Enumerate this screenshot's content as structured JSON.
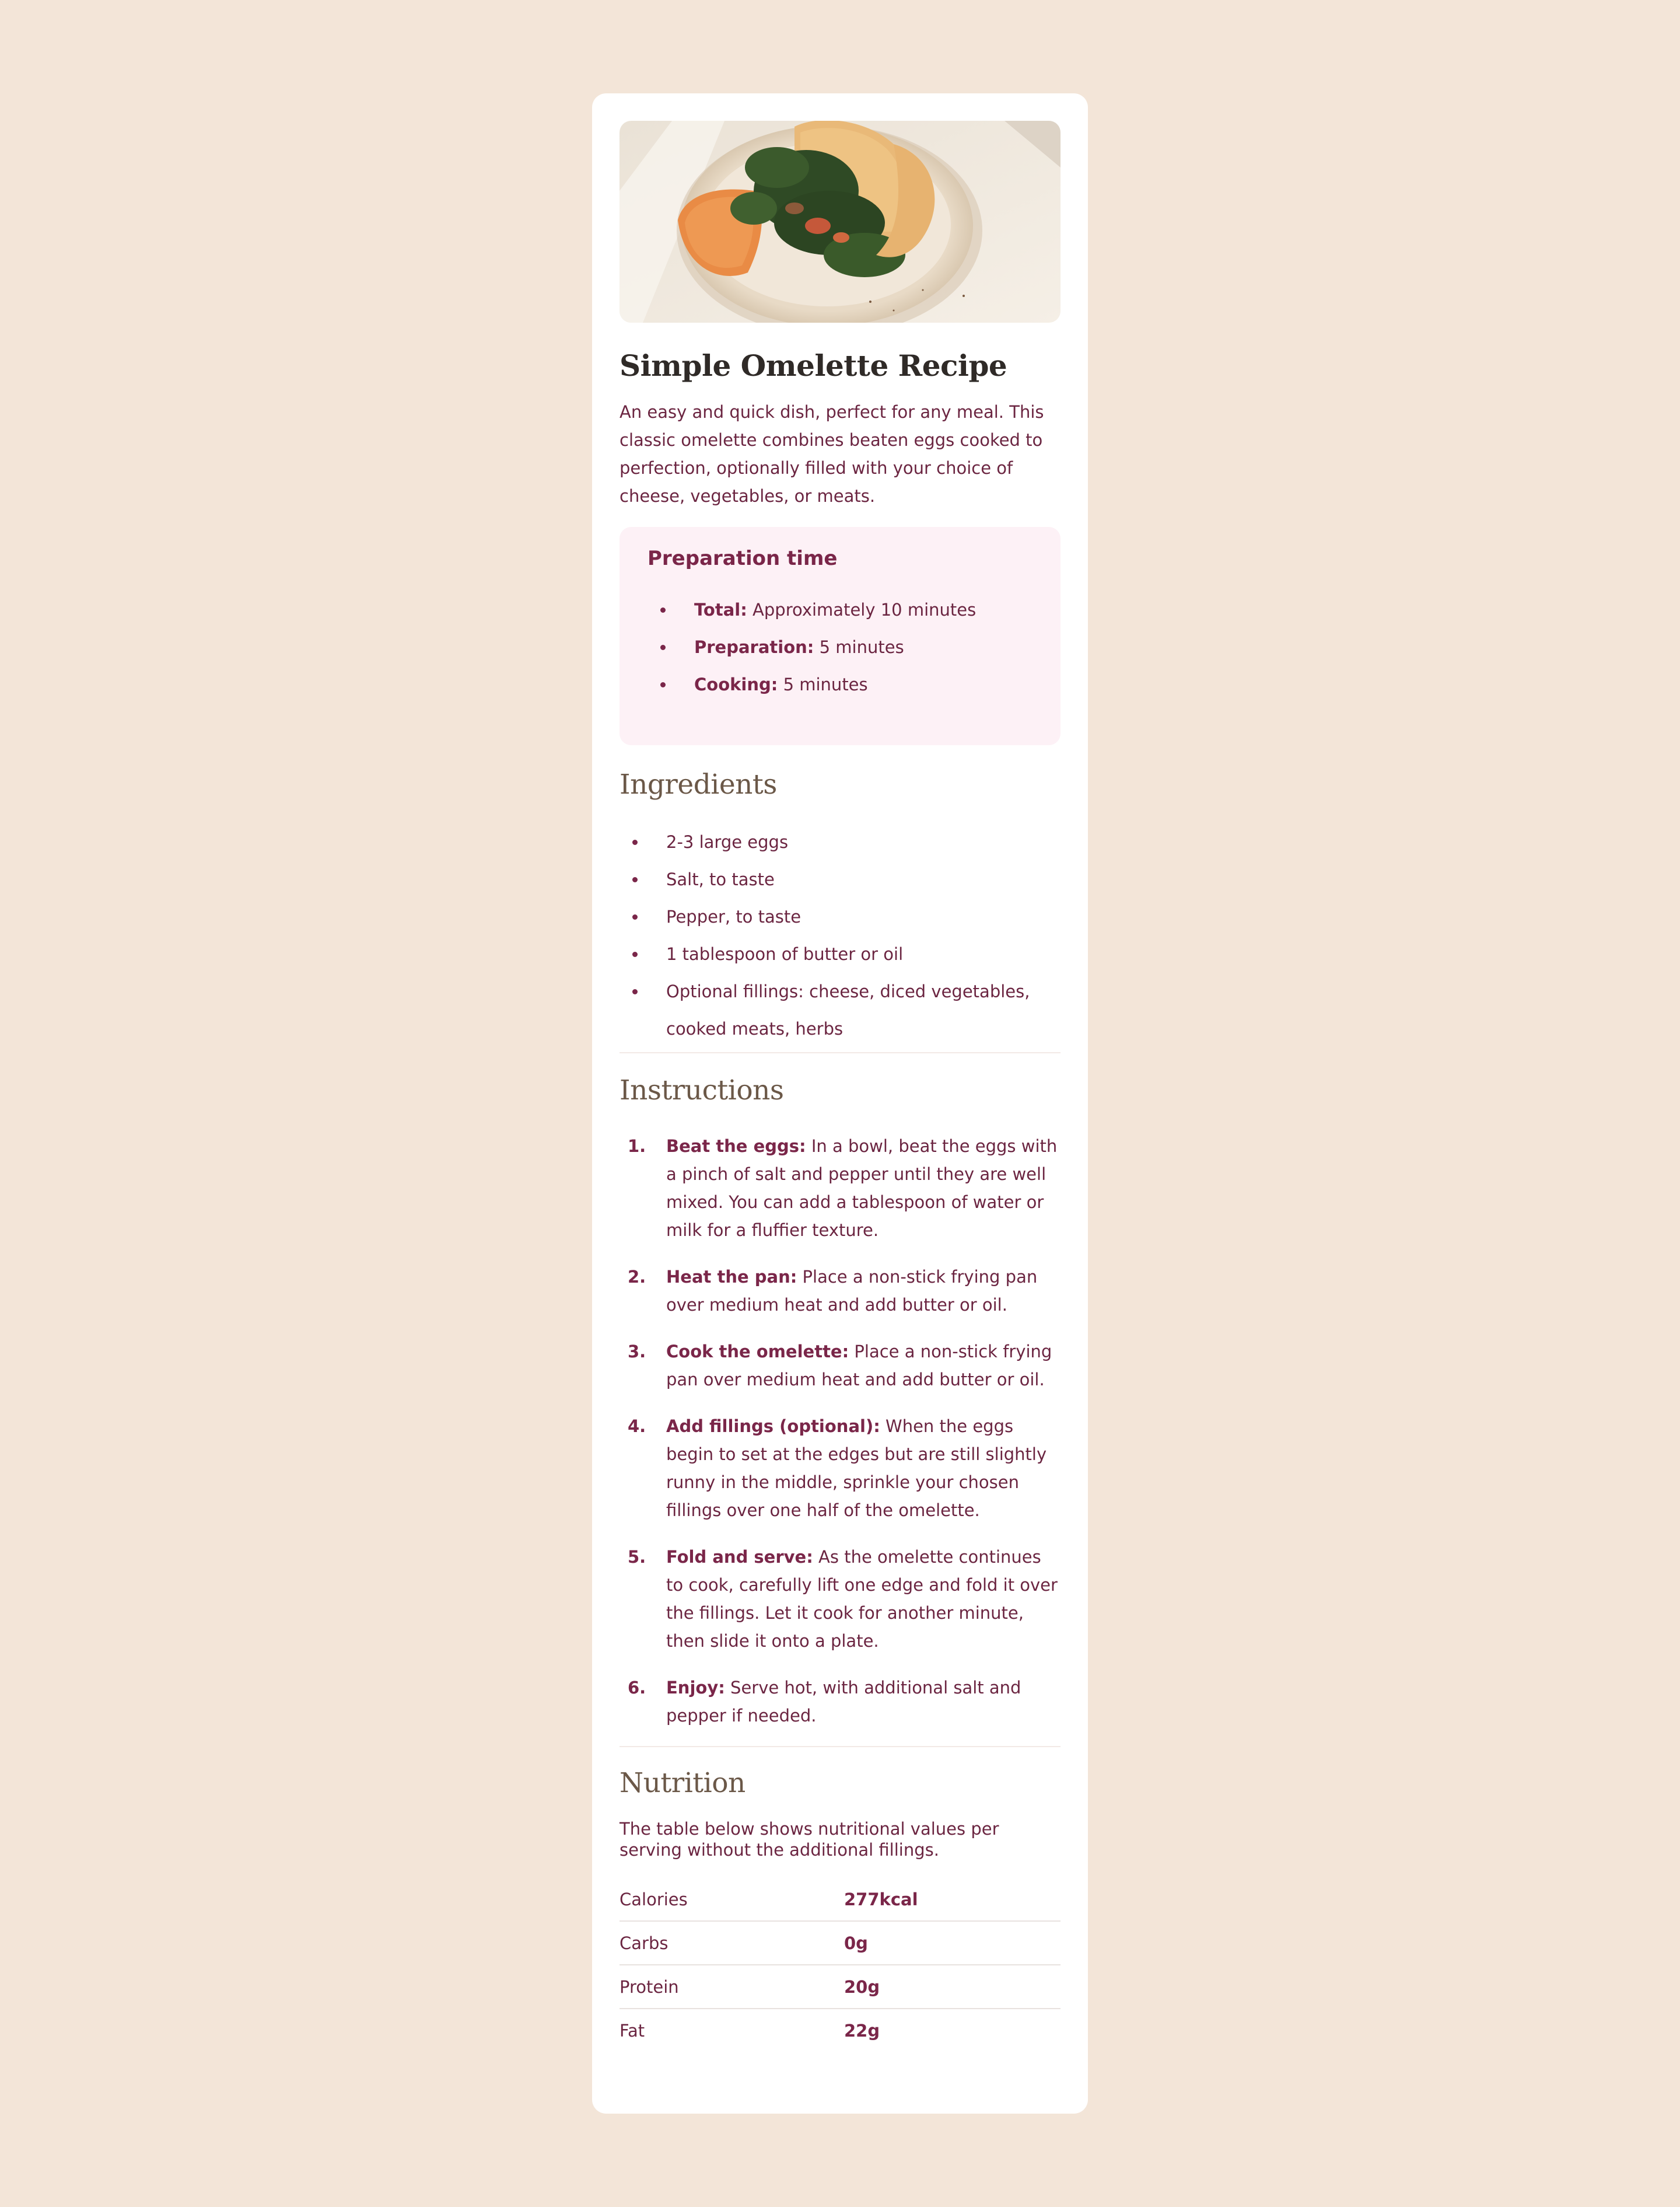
{
  "recipe": {
    "image_alt": "Omelette with spinach on a plate",
    "title": "Simple Omelette Recipe",
    "intro": "An easy and quick dish, perfect for any meal. This classic omelette combines beaten eggs cooked to perfection, optionally filled with your choice of cheese, vegetables, or meats."
  },
  "prep": {
    "title": "Preparation time",
    "items": [
      {
        "label": "Total:",
        "text": " Approximately 10 minutes"
      },
      {
        "label": "Preparation:",
        "text": " 5 minutes"
      },
      {
        "label": "Cooking:",
        "text": " 5 minutes"
      }
    ]
  },
  "ingredients": {
    "title": "Ingredients",
    "items": [
      "2-3 large eggs",
      "Salt, to taste",
      "Pepper, to taste",
      "1 tablespoon of butter or oil",
      "Optional fillings: cheese, diced vegetables, cooked meats, herbs"
    ]
  },
  "instructions": {
    "title": "Instructions",
    "steps": [
      {
        "num": "1.",
        "label": "Beat the eggs:",
        "text": " In a bowl, beat the eggs with a pinch of salt and pepper until they are well mixed. You can add a tablespoon of water or milk for a fluffier texture."
      },
      {
        "num": "2.",
        "label": "Heat the pan:",
        "text": " Place a non-stick frying pan over medium heat and add butter or oil."
      },
      {
        "num": "3.",
        "label": "Cook the omelette:",
        "text": " Place a non-stick frying pan over medium heat and add butter or oil."
      },
      {
        "num": "4.",
        "label": "Add fillings (optional):",
        "text": " When the eggs begin to set at the edges but are still slightly runny in the middle, sprinkle your chosen fillings over one half of the omelette."
      },
      {
        "num": "5.",
        "label": "Fold and serve:",
        "text": " As the omelette continues to cook, carefully lift one edge and fold it over the fillings. Let it cook for another minute, then slide it onto a plate."
      },
      {
        "num": "6.",
        "label": "Enjoy:",
        "text": " Serve hot, with additional salt and pepper if needed."
      }
    ]
  },
  "nutrition": {
    "title": "Nutrition",
    "intro": "The table below shows nutritional values per serving without the additional fillings.",
    "rows": [
      {
        "name": "Calories",
        "value": "277kcal"
      },
      {
        "name": "Carbs",
        "value": "0g"
      },
      {
        "name": "Protein",
        "value": "20g"
      },
      {
        "name": "Fat",
        "value": "22g"
      }
    ]
  }
}
